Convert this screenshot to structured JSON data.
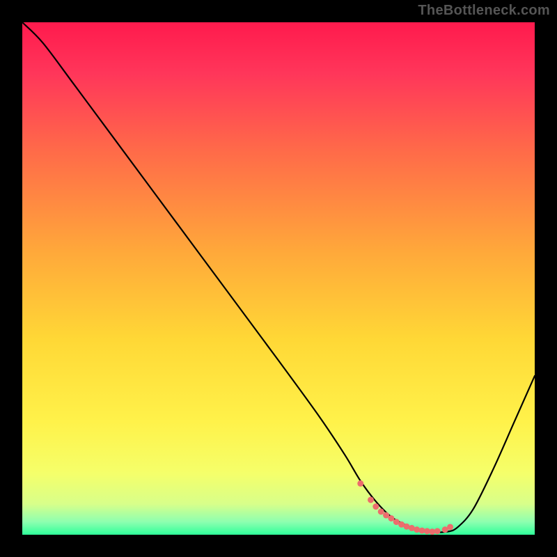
{
  "watermark": "TheBottleneck.com",
  "gradient": {
    "stops": [
      {
        "offset": 0.0,
        "color": "#ff1a4d"
      },
      {
        "offset": 0.1,
        "color": "#ff365a"
      },
      {
        "offset": 0.25,
        "color": "#ff6a49"
      },
      {
        "offset": 0.45,
        "color": "#ffa93a"
      },
      {
        "offset": 0.62,
        "color": "#ffd836"
      },
      {
        "offset": 0.78,
        "color": "#fff24a"
      },
      {
        "offset": 0.88,
        "color": "#f5ff6a"
      },
      {
        "offset": 0.94,
        "color": "#d8ff8a"
      },
      {
        "offset": 0.975,
        "color": "#8dffb0"
      },
      {
        "offset": 1.0,
        "color": "#2fff9a"
      }
    ]
  },
  "chart_data": {
    "type": "line",
    "title": "",
    "xlabel": "",
    "ylabel": "",
    "xlim": [
      0,
      100
    ],
    "ylim": [
      0,
      100
    ],
    "series": [
      {
        "name": "bottleneck-curve",
        "x": [
          0,
          4,
          10,
          20,
          30,
          40,
          50,
          58,
          63,
          66,
          69,
          72,
          75,
          78,
          80,
          83,
          85,
          88,
          92,
          96,
          100
        ],
        "y": [
          100,
          96,
          88,
          74.5,
          61,
          47.5,
          34,
          23,
          15.5,
          10.5,
          6.5,
          3.5,
          1.8,
          0.8,
          0.5,
          0.6,
          1.5,
          5,
          13,
          22,
          31
        ]
      }
    ],
    "flat_region_dots": {
      "x": [
        66,
        68,
        69,
        70,
        71,
        72,
        73,
        74,
        75,
        76,
        77,
        78,
        79,
        80,
        81,
        82.5,
        83.5
      ],
      "y": [
        10,
        6.8,
        5.5,
        4.5,
        3.8,
        3.2,
        2.5,
        2.0,
        1.6,
        1.3,
        1.0,
        0.8,
        0.7,
        0.6,
        0.7,
        1.0,
        1.5
      ]
    }
  }
}
